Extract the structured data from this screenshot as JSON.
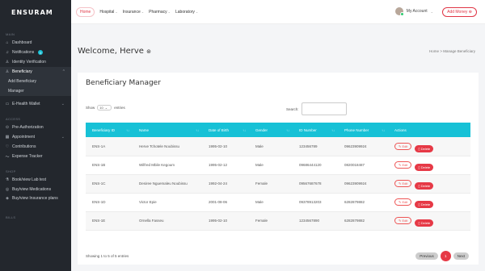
{
  "app": {
    "logo": "ENSURAM"
  },
  "sidebar": {
    "sections": {
      "main": "MAIN",
      "access": "ACCESS",
      "shop": "SHOP",
      "bills": "BILLS"
    },
    "items": [
      {
        "label": "Dashboard",
        "icon": "home-icon"
      },
      {
        "label": "Notifications",
        "icon": "bell-icon",
        "badge": "0"
      },
      {
        "label": "Identity Verification",
        "icon": "user-icon"
      },
      {
        "label": "Beneficiary",
        "icon": "users-icon"
      }
    ],
    "beneficiary_sub": [
      "Add Beneficiary",
      "Manager"
    ],
    "items2": [
      {
        "label": "E-Health Wallet",
        "icon": "wallet-icon"
      }
    ],
    "access_items": [
      {
        "label": "Pre-Authorization",
        "icon": "check-icon"
      },
      {
        "label": "Appointment",
        "icon": "calendar-icon"
      },
      {
        "label": "Contributions",
        "icon": "heart-icon"
      },
      {
        "label": "Expense Tracker",
        "icon": "chart-icon"
      }
    ],
    "shop_items": [
      {
        "label": "Book/view Lab test",
        "icon": "flask-icon"
      },
      {
        "label": "Buy/view Medications",
        "icon": "pill-icon"
      },
      {
        "label": "Buy/view Insurance plans",
        "icon": "shield-icon"
      }
    ]
  },
  "topbar": {
    "nav": [
      "Home",
      "Hospital",
      "Insurance",
      "Pharmacy",
      "Laboratory"
    ],
    "account": "My Account",
    "add_money": "Add Money"
  },
  "page": {
    "welcome": "Welcome, Herve",
    "breadcrumb": [
      "Home",
      "Manage Beneficiary"
    ]
  },
  "card": {
    "title": "Beneficiary Manager",
    "show_label": "Show",
    "show_value": "10",
    "entries_label": "entries",
    "search_label": "Search:",
    "columns": [
      "Beneficiary ID",
      "Name",
      "Date of Birth",
      "Gender",
      "ID Number",
      "Phone Number",
      "Actions"
    ],
    "rows": [
      [
        "ENS-1A",
        "Herve Tchotele Noubissu",
        "1995-02-10",
        "Male",
        "123456789",
        "09623909924"
      ],
      [
        "ENS-1B",
        "Wilfred Mbile Kegoum",
        "1995-02-12",
        "Male",
        "09686444120",
        "0820018487"
      ],
      [
        "ENS-1C",
        "Desiree Nguemaleu Noubissu",
        "1992-04-24",
        "Female",
        "09567687678",
        "09623909924"
      ],
      [
        "ENS-1D",
        "Victor Epie",
        "2001-08-06",
        "Male",
        "09378913203",
        "6282879882"
      ],
      [
        "ENS-1E",
        "Ornella Fasseu",
        "1995-02-10",
        "Female",
        "1234567890",
        "6282879882"
      ]
    ],
    "edit_label": "Edit",
    "delete_label": "Delete",
    "info": "Showing 1 to 5 of 5 entries",
    "prev": "Previous",
    "page": "1",
    "next": "Next"
  }
}
